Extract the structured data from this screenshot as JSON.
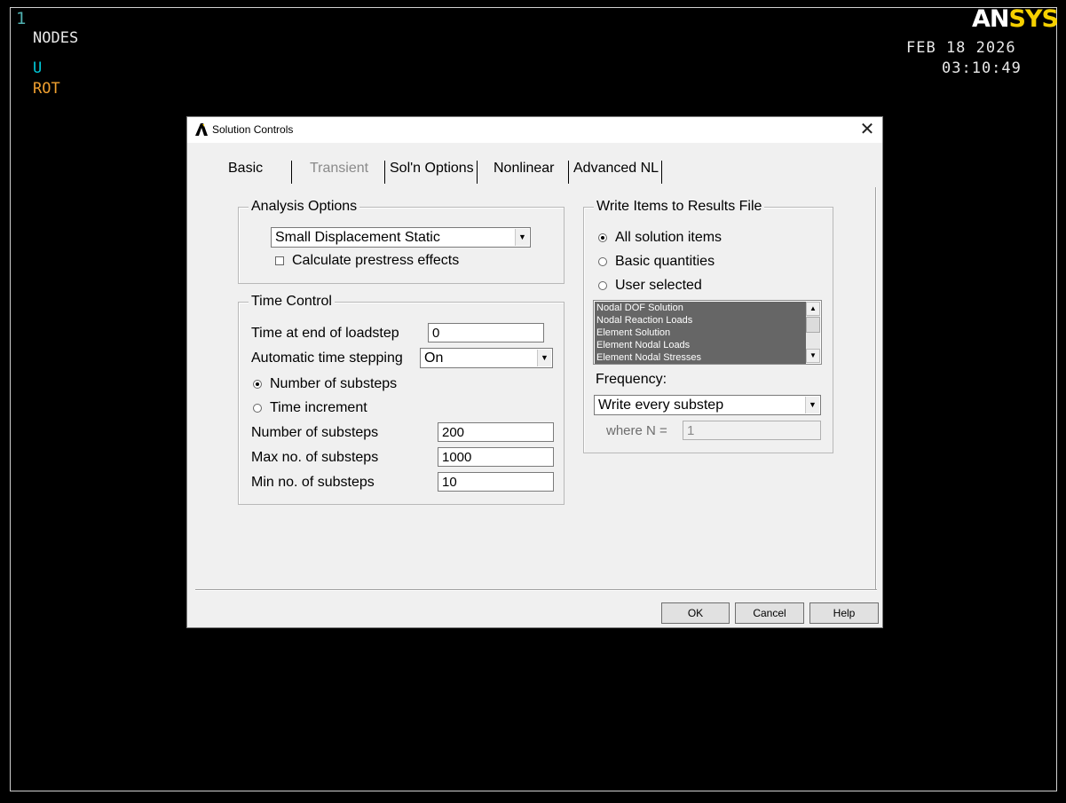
{
  "graphics": {
    "window_number": "1",
    "label_nodes": "NODES",
    "label_u": "U",
    "label_rot": "ROT",
    "logo_part1": "AN",
    "logo_part2": "SYS",
    "date": "FEB 18 2026",
    "time": "03:10:49"
  },
  "dialog": {
    "title": "Solution Controls",
    "tabs": [
      {
        "label": "Basic",
        "state": "active"
      },
      {
        "label": "Transient",
        "state": "disabled"
      },
      {
        "label": "Sol'n Options",
        "state": "normal"
      },
      {
        "label": "Nonlinear",
        "state": "normal"
      },
      {
        "label": "Advanced NL",
        "state": "normal"
      }
    ],
    "analysis_options": {
      "group_title": "Analysis Options",
      "analysis_type": "Small Displacement Static",
      "prestress_label": "Calculate prestress effects",
      "prestress_checked": false
    },
    "time_control": {
      "group_title": "Time Control",
      "time_end_label": "Time at end of loadstep",
      "time_end_value": "0",
      "auto_step_label": "Automatic time stepping",
      "auto_step_value": "On",
      "radio_substeps_label": "Number of substeps",
      "radio_increment_label": "Time increment",
      "selected_radio": "Number of substeps",
      "num_substeps_label": "Number of substeps",
      "num_substeps_value": "200",
      "max_substeps_label": "Max no. of substeps",
      "max_substeps_value": "1000",
      "min_substeps_label": "Min no. of substeps",
      "min_substeps_value": "10"
    },
    "results_file": {
      "group_title": "Write Items to Results File",
      "radio_all": "All solution items",
      "radio_basic": "Basic quantities",
      "radio_user": "User selected",
      "selected_radio": "All solution items",
      "items": [
        "Nodal DOF Solution",
        "Nodal Reaction Loads",
        "Element Solution",
        "Element Nodal Loads",
        "Element Nodal Stresses"
      ],
      "frequency_label": "Frequency:",
      "frequency_value": "Write every substep",
      "where_n_label": "where N =",
      "where_n_value": "1"
    },
    "buttons": {
      "ok": "OK",
      "cancel": "Cancel",
      "help": "Help"
    }
  },
  "colors": {
    "background": "#000000",
    "window_number": "#4fb0b0",
    "u_label": "#00c8d8",
    "rot_label": "#f0a030",
    "logo_white": "#ffffff",
    "logo_yellow": "#f5d000"
  }
}
